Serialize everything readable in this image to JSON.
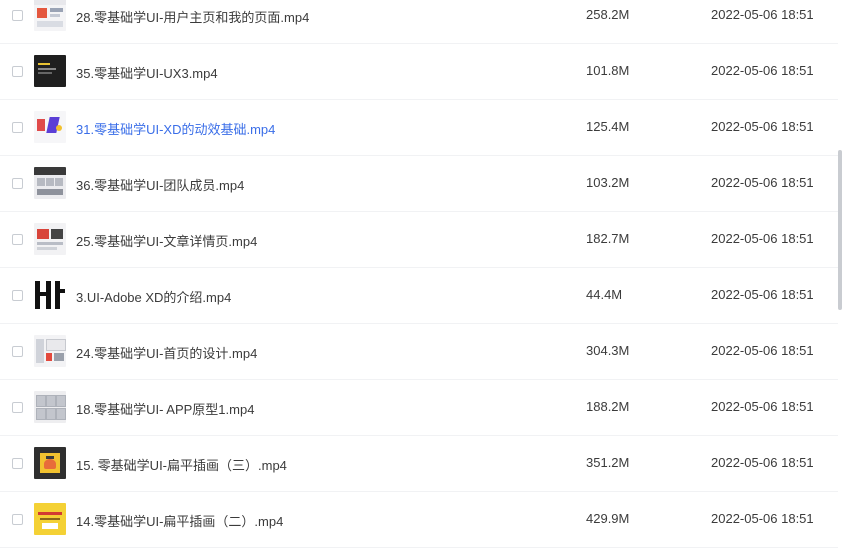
{
  "files": [
    {
      "name": "28.零基础学UI-用户主页和我的页面.mp4",
      "size": "258.2M",
      "date": "2022-05-06 18:51",
      "thumb": "slide",
      "highlight": false
    },
    {
      "name": "35.零基础学UI-UX3.mp4",
      "size": "101.8M",
      "date": "2022-05-06 18:51",
      "thumb": "dark",
      "highlight": false
    },
    {
      "name": "31.零基础学UI-XD的动效基础.mp4",
      "size": "125.4M",
      "date": "2022-05-06 18:51",
      "thumb": "xd",
      "highlight": true
    },
    {
      "name": "36.零基础学UI-团队成员.mp4",
      "size": "103.2M",
      "date": "2022-05-06 18:51",
      "thumb": "team",
      "highlight": false
    },
    {
      "name": "25.零基础学UI-文章详情页.mp4",
      "size": "182.7M",
      "date": "2022-05-06 18:51",
      "thumb": "article",
      "highlight": false
    },
    {
      "name": "3.UI-Adobe XD的介绍.mp4",
      "size": "44.4M",
      "date": "2022-05-06 18:51",
      "thumb": "adobe",
      "highlight": false
    },
    {
      "name": "24.零基础学UI-首页的设计.mp4",
      "size": "304.3M",
      "date": "2022-05-06 18:51",
      "thumb": "home",
      "highlight": false
    },
    {
      "name": "18.零基础学UI- APP原型1.mp4",
      "size": "188.2M",
      "date": "2022-05-06 18:51",
      "thumb": "app",
      "highlight": false
    },
    {
      "name": "15. 零基础学UI-扁平插画（三）.mp4",
      "size": "351.2M",
      "date": "2022-05-06 18:51",
      "thumb": "flat",
      "highlight": false
    },
    {
      "name": "14.零基础学UI-扁平插画（二）.mp4",
      "size": "429.9M",
      "date": "2022-05-06 18:51",
      "thumb": "flat2",
      "highlight": false
    }
  ],
  "colors": {
    "text": "#3b3b3b",
    "highlight": "#3a6ee8",
    "divider": "#f1f2f4"
  }
}
